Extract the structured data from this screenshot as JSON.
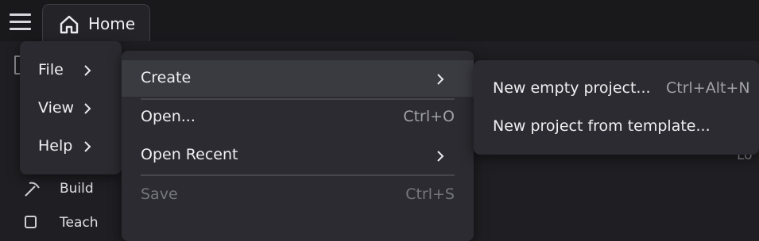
{
  "header": {
    "menu_icon": "hamburger-menu-icon",
    "tab": {
      "label": "Home",
      "icon": "home-icon"
    }
  },
  "background": {
    "build_label": "Build",
    "build_icon": "pickaxe-icon",
    "teach_label": "Teach",
    "teach_icon": "teach-icon",
    "partial_text": "Lo"
  },
  "main_menu": {
    "items": [
      {
        "label": "File"
      },
      {
        "label": "View"
      },
      {
        "label": "Help"
      }
    ]
  },
  "file_menu": {
    "items": [
      {
        "label": "Create",
        "shortcut": "",
        "submenu": true,
        "highlighted": true
      },
      {
        "label": "Open...",
        "shortcut": "Ctrl+O"
      },
      {
        "label": "Open Recent",
        "shortcut": "",
        "submenu": true
      },
      {
        "label": "Save",
        "shortcut": "Ctrl+S",
        "disabled": true
      }
    ]
  },
  "create_menu": {
    "items": [
      {
        "label": "New empty project...",
        "shortcut": "Ctrl+Alt+N"
      },
      {
        "label": "New project from template...",
        "shortcut": ""
      }
    ]
  },
  "colors": {
    "background": "#1f1f23",
    "topbar": "#19191c",
    "menu": "#2b2b31",
    "menu_highlight": "#3a3a41",
    "text": "#f0f0f3",
    "shortcut_text": "#a2a2aa",
    "disabled_text": "#76767e"
  }
}
